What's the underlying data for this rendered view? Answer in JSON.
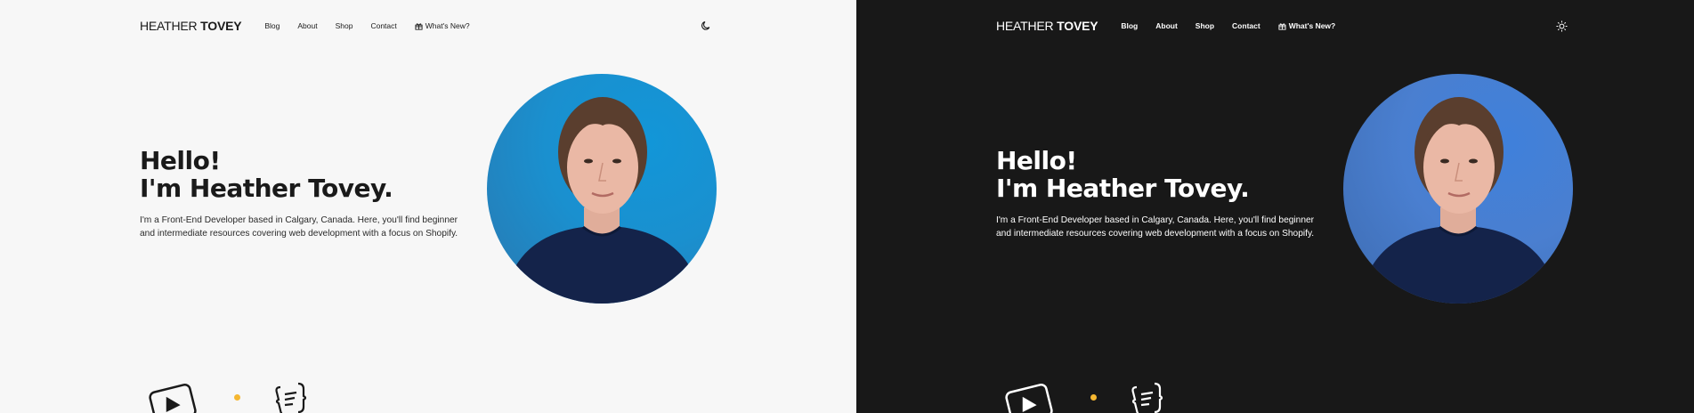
{
  "brand": {
    "first": "HEATHER ",
    "last": "TOVEY"
  },
  "nav": {
    "blog": "Blog",
    "about": "About",
    "shop": "Shop",
    "contact": "Contact",
    "whats_new": "What's New?"
  },
  "hero": {
    "line1": "Hello!",
    "line2": "I'm Heather Tovey.",
    "desc_line1": "I'm a Front-End Developer based in Calgary, Canada. Here, you'll find beginner",
    "desc_line2": "and intermediate resources covering web development with a focus on Shopify."
  },
  "icons": {
    "gift": "gift-icon",
    "moon": "moon-icon",
    "sun": "sun-icon",
    "play": "play-icon",
    "document": "document-icon"
  },
  "colors": {
    "light_bg": "#f7f7f7",
    "dark_bg": "#181818",
    "accent_dot": "#f5b731",
    "avatar_bg_light": "#1a90cf",
    "avatar_bg_dark": "#4a7fd0"
  }
}
